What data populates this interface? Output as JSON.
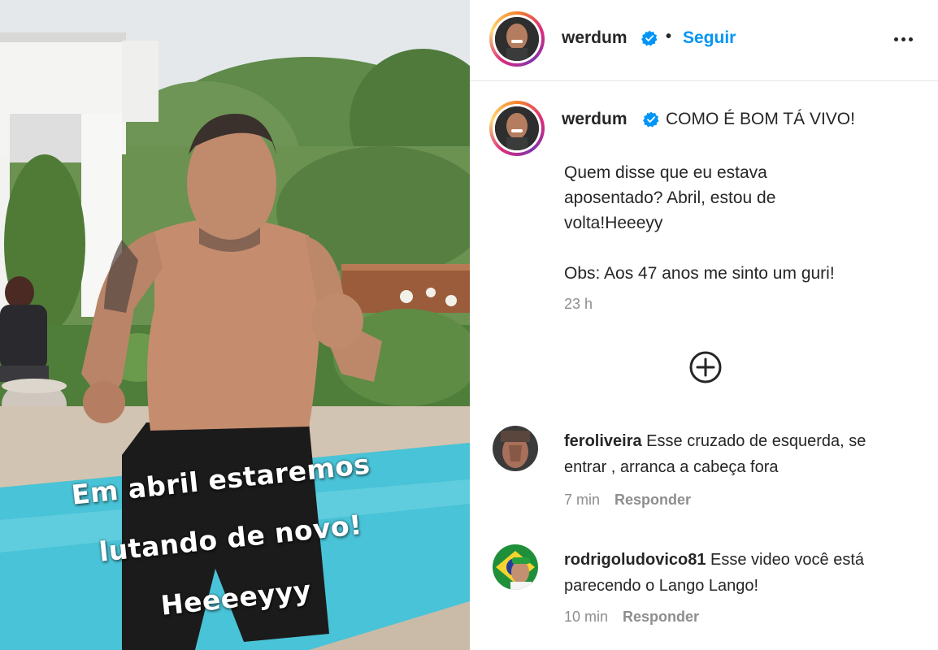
{
  "media": {
    "caption_lines": [
      "Em abril estaremos",
      "lutando de novo!",
      "Heeeeyyy"
    ]
  },
  "header": {
    "username": "werdum",
    "separator": "•",
    "follow_label": "Seguir"
  },
  "caption": {
    "username": "werdum",
    "title": "COMO É BOM TÁ VIVO!",
    "body_lines": [
      "Quem disse que eu estava",
      "aposentado? Abril, estou de",
      "volta!Heeeyy"
    ],
    "obs": "Obs: Aos 47 anos me sinto um guri!",
    "time": "23 h"
  },
  "comments": [
    {
      "username": "feroliveira",
      "text_first": "Esse cruzado de esquerda, se",
      "text_second": "entrar , arranca a cabeça fora",
      "time": "7 min",
      "reply_label": "Responder"
    },
    {
      "username": "rodrigoludovico81",
      "text_first": "Esse video você está",
      "text_second": "parecendo o Lango Lango!",
      "time": "10 min",
      "reply_label": "Responder"
    }
  ],
  "colors": {
    "accent": "#0095f6",
    "secondary_text": "#8e8e8e",
    "primary_text": "#262626"
  },
  "icons": [
    "verified-badge-icon",
    "more-options-icon",
    "load-more-comments-icon"
  ]
}
